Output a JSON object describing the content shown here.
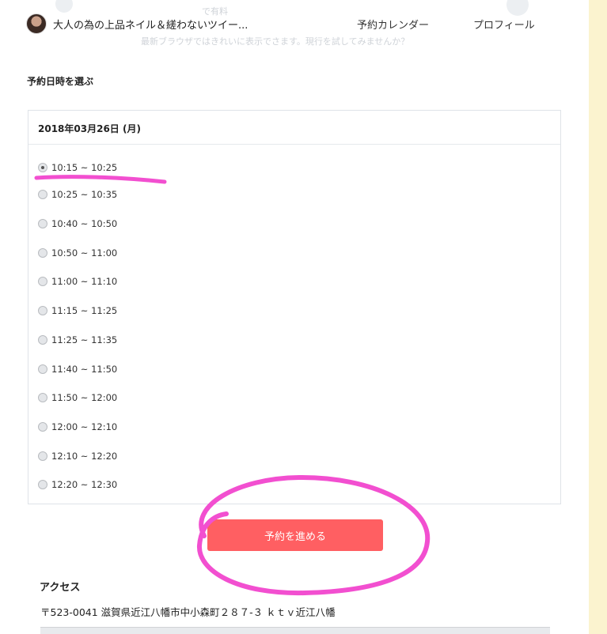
{
  "header": {
    "shop_name": "大人の為の上品ネイル＆縒わないツイー...",
    "nav": [
      "予約カレンダー",
      "プロフィール"
    ],
    "ghost_banner": "最新ブラウザではきれいに表示でさます。現行を試してみませんか？",
    "ghost_small": "で有料"
  },
  "reservation": {
    "section_title": "予約日時を選ぶ",
    "date": "2018年03月26日 (月)",
    "slots": [
      "10:15 ~ 10:25",
      "10:25 ~ 10:35",
      "10:40 ~ 10:50",
      "10:50 ~ 11:00",
      "11:00 ~ 11:10",
      "11:15 ~ 11:25",
      "11:25 ~ 11:35",
      "11:40 ~ 11:50",
      "11:50 ~ 12:00",
      "12:00 ~ 12:10",
      "12:10 ~ 12:20",
      "12:20 ~ 12:30"
    ],
    "selected_slot": "10:15 ~ 10:25",
    "submit_label": "予約を進める"
  },
  "access": {
    "title": "アクセス",
    "address": "〒523-0041 滋賀県近江八幡市中小森町２８７-３ ｋｔｖ近江八幡"
  },
  "colors": {
    "accent_button": "#ff5f62",
    "annotation_marker": "#f24fd0",
    "page_background": "#fbf3cf"
  }
}
